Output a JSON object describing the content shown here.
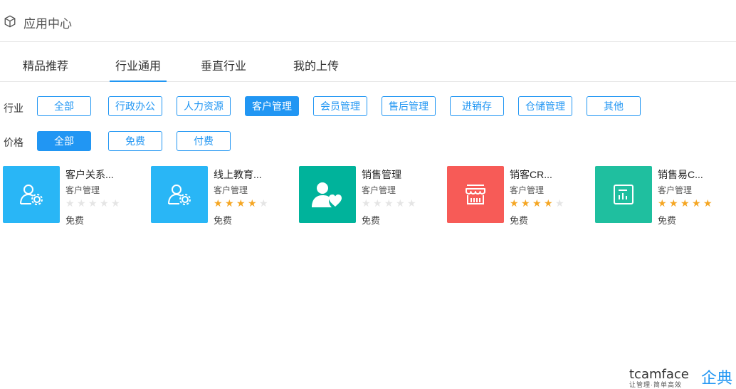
{
  "header": {
    "title": "应用中心",
    "icon": "cube-icon"
  },
  "tabs": [
    {
      "label": "精品推荐",
      "active": false
    },
    {
      "label": "行业通用",
      "active": true
    },
    {
      "label": "垂直行业",
      "active": false
    },
    {
      "label": "我的上传",
      "active": false
    }
  ],
  "filters": {
    "industry": {
      "label": "行业",
      "options": [
        "全部",
        "行政办公",
        "人力资源",
        "客户管理",
        "会员管理",
        "售后管理",
        "进销存",
        "仓储管理",
        "其他"
      ],
      "selected": "客户管理"
    },
    "price": {
      "label": "价格",
      "options": [
        "全部",
        "免费",
        "付费"
      ],
      "selected": "全部"
    }
  },
  "colors": {
    "accent": "#2196f3",
    "star_on": "#f5a623",
    "star_off": "#e5e5e5"
  },
  "apps": [
    {
      "name": "客户关系...",
      "category": "客户管理",
      "rating": 0,
      "price": "免费",
      "color": "#29b6f6",
      "icon": "user-gear-icon"
    },
    {
      "name": "线上教育...",
      "category": "客户管理",
      "rating": 4,
      "price": "免费",
      "color": "#29b6f6",
      "icon": "user-gear-icon"
    },
    {
      "name": "销售管理",
      "category": "客户管理",
      "rating": 0,
      "price": "免费",
      "color": "#00b39b",
      "icon": "user-heart-icon"
    },
    {
      "name": "销客CR...",
      "category": "客户管理",
      "rating": 4,
      "price": "免费",
      "color": "#f75b57",
      "icon": "storefront-icon"
    },
    {
      "name": "销售易C...",
      "category": "客户管理",
      "rating": 5,
      "price": "免费",
      "color": "#1fbf9f",
      "icon": "report-icon"
    }
  ],
  "brand": {
    "name_en": "tcamface",
    "name_cn": "企典",
    "slogan": "让管理·简单高效"
  }
}
